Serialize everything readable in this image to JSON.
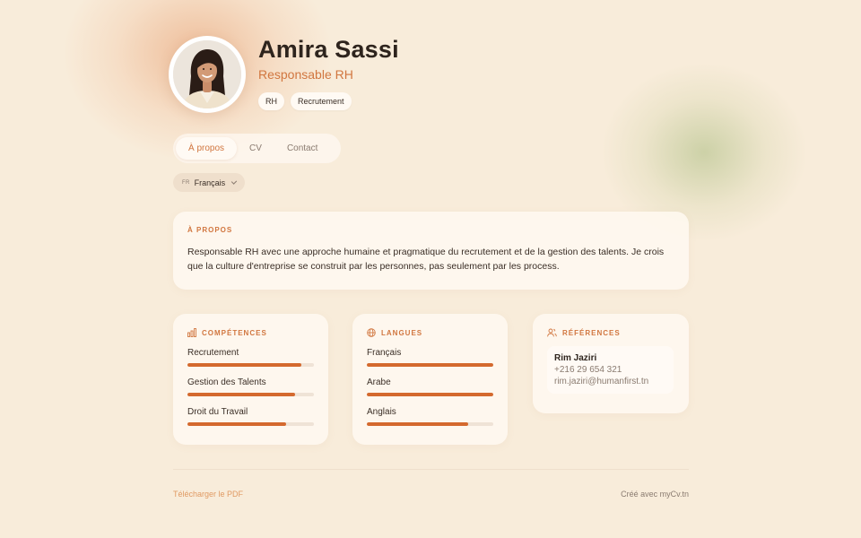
{
  "profile": {
    "name": "Amira Sassi",
    "role": "Responsable RH",
    "tags": [
      "RH",
      "Recrutement"
    ]
  },
  "tabs": [
    {
      "label": "À propos",
      "active": true
    },
    {
      "label": "CV",
      "active": false
    },
    {
      "label": "Contact",
      "active": false
    }
  ],
  "language_select": {
    "code": "FR",
    "value": "Français"
  },
  "about": {
    "title": "À PROPOS",
    "text": "Responsable RH avec une approche humaine et pragmatique du recrutement et de la gestion des talents. Je crois que la culture d'entreprise se construit par les personnes, pas seulement par les process."
  },
  "skills": {
    "title": "COMPÉTENCES",
    "icon": "bar-chart-icon",
    "items": [
      {
        "label": "Recrutement",
        "level": 0.9
      },
      {
        "label": "Gestion des Talents",
        "level": 0.85
      },
      {
        "label": "Droit du Travail",
        "level": 0.78
      }
    ]
  },
  "languages": {
    "title": "LANGUES",
    "icon": "globe-icon",
    "items": [
      {
        "label": "Français",
        "level": 1.0
      },
      {
        "label": "Arabe",
        "level": 1.0
      },
      {
        "label": "Anglais",
        "level": 0.8
      }
    ]
  },
  "references": {
    "title": "RÉFÉRENCES",
    "icon": "users-icon",
    "items": [
      {
        "name": "Rim Jaziri",
        "phone": "+216 29 654 321",
        "email": "rim.jaziri@humanfirst.tn"
      }
    ]
  },
  "footer": {
    "download_label": "Télécharger le PDF",
    "credit": "Créé avec myCv.tn"
  },
  "colors": {
    "accent": "#d1763f",
    "bar": "#d4692e",
    "background": "#f8ecda"
  }
}
